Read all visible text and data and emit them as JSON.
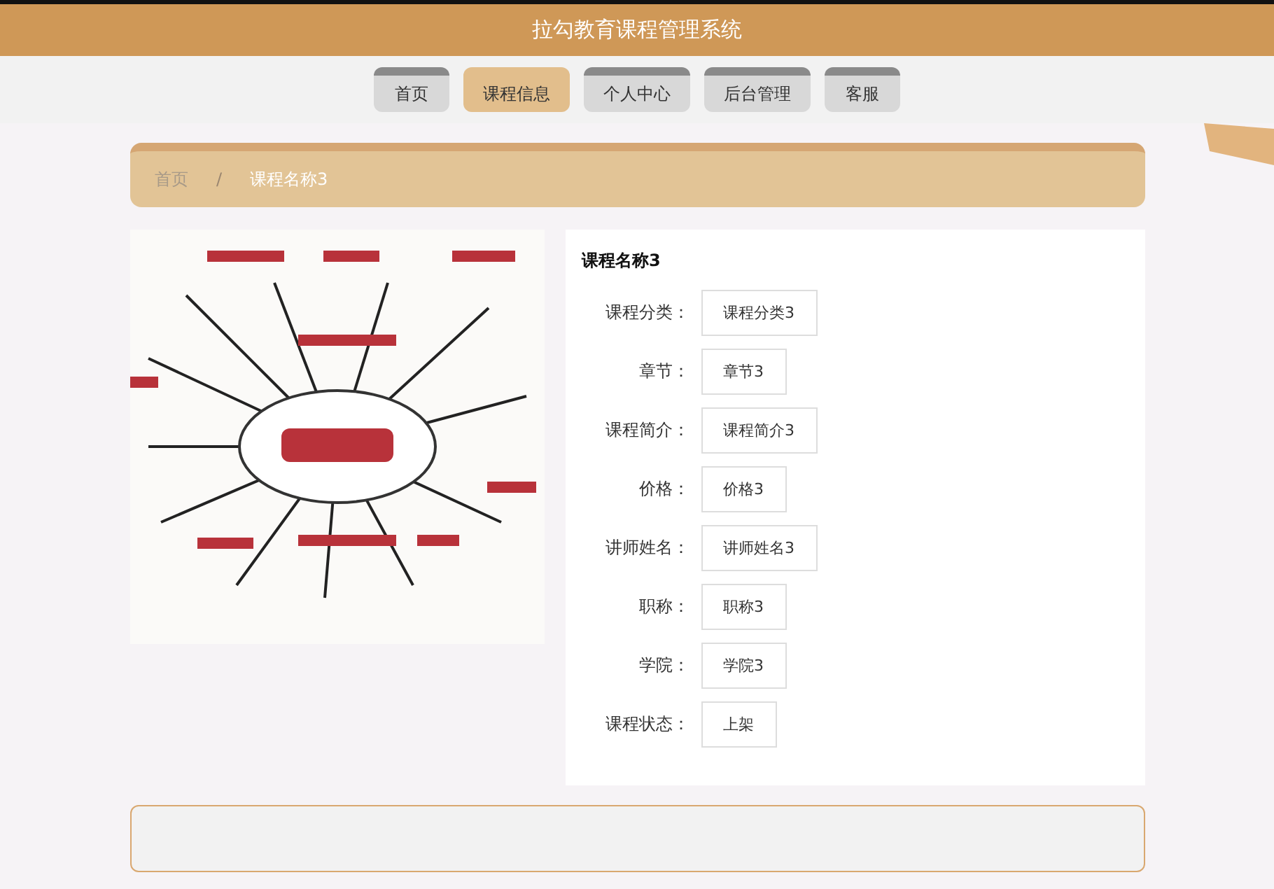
{
  "header": {
    "title": "拉勾教育课程管理系统"
  },
  "nav": [
    {
      "label": "首页",
      "selected": false
    },
    {
      "label": "课程信息",
      "selected": true
    },
    {
      "label": "个人中心",
      "selected": false
    },
    {
      "label": "后台管理",
      "selected": false
    },
    {
      "label": "客服",
      "selected": false
    }
  ],
  "breadcrumb": [
    "首页",
    "/",
    "课程名称3"
  ],
  "course": {
    "title": "课程名称3",
    "fields": [
      {
        "label": "课程分类：",
        "value": "课程分类3"
      },
      {
        "label": "章节：",
        "value": "章节3"
      },
      {
        "label": "课程简介：",
        "value": "课程简介3"
      },
      {
        "label": "价格：",
        "value": "价格3"
      },
      {
        "label": "讲师姓名：",
        "value": "讲师姓名3"
      },
      {
        "label": "职称：",
        "value": "职称3"
      },
      {
        "label": "学院：",
        "value": "学院3"
      },
      {
        "label": "课程状态：",
        "value": "上架"
      }
    ]
  }
}
